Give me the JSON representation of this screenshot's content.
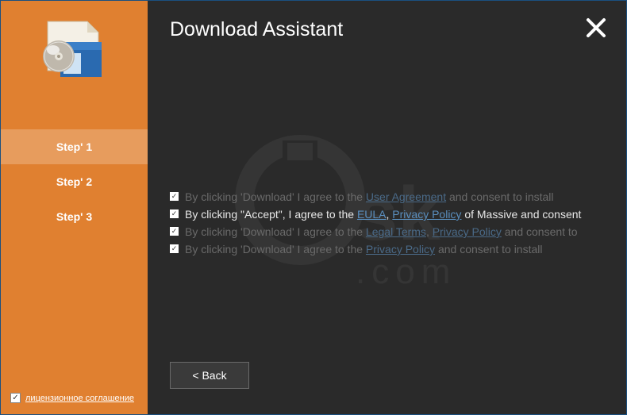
{
  "header": {
    "title": "Download Assistant"
  },
  "sidebar": {
    "steps": [
      {
        "label": "Step' 1",
        "active": true
      },
      {
        "label": "Step' 2",
        "active": false
      },
      {
        "label": "Step' 3",
        "active": false
      }
    ],
    "bottom_checkbox": {
      "checked": true,
      "label": "лицензионное соглашение"
    }
  },
  "agreements": [
    {
      "style": "faded",
      "checked": true,
      "segments": [
        {
          "t": "text",
          "v": "By clicking 'Download' I agree to the "
        },
        {
          "t": "link",
          "v": "User Agreement"
        },
        {
          "t": "text",
          "v": " and consent to install"
        }
      ]
    },
    {
      "style": "bright",
      "checked": true,
      "segments": [
        {
          "t": "text",
          "v": "By clicking \"Accept\", I agree to the "
        },
        {
          "t": "link",
          "v": "EULA"
        },
        {
          "t": "text",
          "v": ", "
        },
        {
          "t": "link",
          "v": "Privacy Policy"
        },
        {
          "t": "text",
          "v": " of Massive and consent"
        }
      ]
    },
    {
      "style": "faded",
      "checked": true,
      "segments": [
        {
          "t": "text",
          "v": "By clicking 'Download' I agree to the "
        },
        {
          "t": "link",
          "v": "Legal Terms"
        },
        {
          "t": "text",
          "v": ", "
        },
        {
          "t": "link",
          "v": "Privacy Policy"
        },
        {
          "t": "text",
          "v": " and consent to"
        }
      ]
    },
    {
      "style": "faded",
      "checked": true,
      "segments": [
        {
          "t": "text",
          "v": "By clicking 'Download' I agree to the "
        },
        {
          "t": "link",
          "v": "Privacy Policy"
        },
        {
          "t": "text",
          "v": " and consent to install"
        }
      ]
    }
  ],
  "buttons": {
    "back": "<  Back"
  },
  "icons": {
    "close": "close",
    "installer": "installer-package"
  }
}
